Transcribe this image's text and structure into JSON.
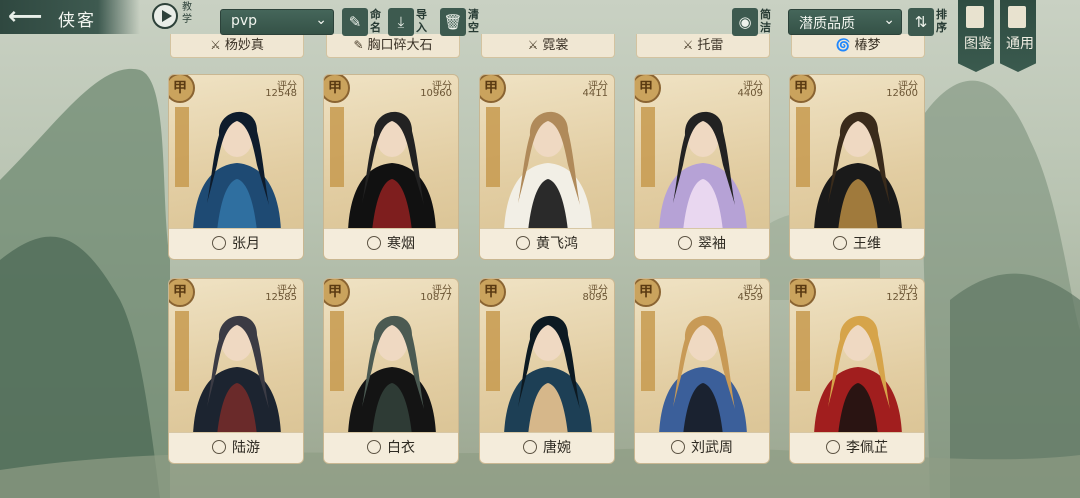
{
  "header": {
    "back_arrow_icon": "back-arrow-icon",
    "title": "侠客",
    "tutorial_label": "教学",
    "filter_value": "pvp",
    "rename_label": "命名",
    "import_label": "导入",
    "clear_label": "清空",
    "compact_label": "简洁",
    "quality_value": "潜质品质",
    "sort_label": "排序"
  },
  "side": {
    "atlas_label": "图鉴",
    "general_label": "通用"
  },
  "top_row_partial": [
    {
      "name": "杨妙真",
      "icon": "sword-icon"
    },
    {
      "name": "胸口碎大石",
      "icon": "brush-icon"
    },
    {
      "name": "霓裳",
      "icon": "sword-icon"
    },
    {
      "name": "托雷",
      "icon": "sword-icon"
    },
    {
      "name": "椿梦",
      "icon": "swirl-icon"
    }
  ],
  "score_label": "评分",
  "cards": [
    {
      "grade": "甲",
      "score": "12548",
      "name": "张月",
      "icon": "shield-icon",
      "palette": [
        "#1e4a73",
        "#2f6fa0",
        "#0e1c2c"
      ]
    },
    {
      "grade": "甲",
      "score": "10960",
      "name": "寒烟",
      "icon": "sword-icon",
      "palette": [
        "#111111",
        "#7e1e1e",
        "#222222"
      ]
    },
    {
      "grade": "甲",
      "score": "4411",
      "name": "黄飞鸿",
      "icon": "lotus-icon",
      "palette": [
        "#f2efe6",
        "#2a2a2a",
        "#b08a5a"
      ]
    },
    {
      "grade": "甲",
      "score": "4409",
      "name": "翠袖",
      "icon": "lotus-icon",
      "palette": [
        "#b6a2d6",
        "#e9d7f0",
        "#222222"
      ]
    },
    {
      "grade": "甲",
      "score": "12600",
      "name": "王维",
      "icon": "lotus-icon",
      "palette": [
        "#1a1a1a",
        "#a07a3c",
        "#3a2b1b"
      ]
    },
    {
      "grade": "甲",
      "score": "12585",
      "name": "陆游",
      "icon": "swirl-icon",
      "palette": [
        "#1c2430",
        "#6a2a2a",
        "#3b3b44"
      ]
    },
    {
      "grade": "甲",
      "score": "10877",
      "name": "白衣",
      "icon": "shield-icon",
      "palette": [
        "#141414",
        "#2e3b35",
        "#4b5a52"
      ]
    },
    {
      "grade": "甲",
      "score": "8095",
      "name": "唐婉",
      "icon": "lotus-icon",
      "palette": [
        "#1d3f55",
        "#d6b78a",
        "#0d1a22"
      ]
    },
    {
      "grade": "甲",
      "score": "4559",
      "name": "刘武周",
      "icon": "sword-icon",
      "palette": [
        "#3b5f9a",
        "#1a2230",
        "#c89a56"
      ]
    },
    {
      "grade": "甲",
      "score": "12213",
      "name": "李佩芷",
      "icon": "sword-icon",
      "palette": [
        "#a11e1e",
        "#2a1412",
        "#d6a44a"
      ]
    }
  ]
}
